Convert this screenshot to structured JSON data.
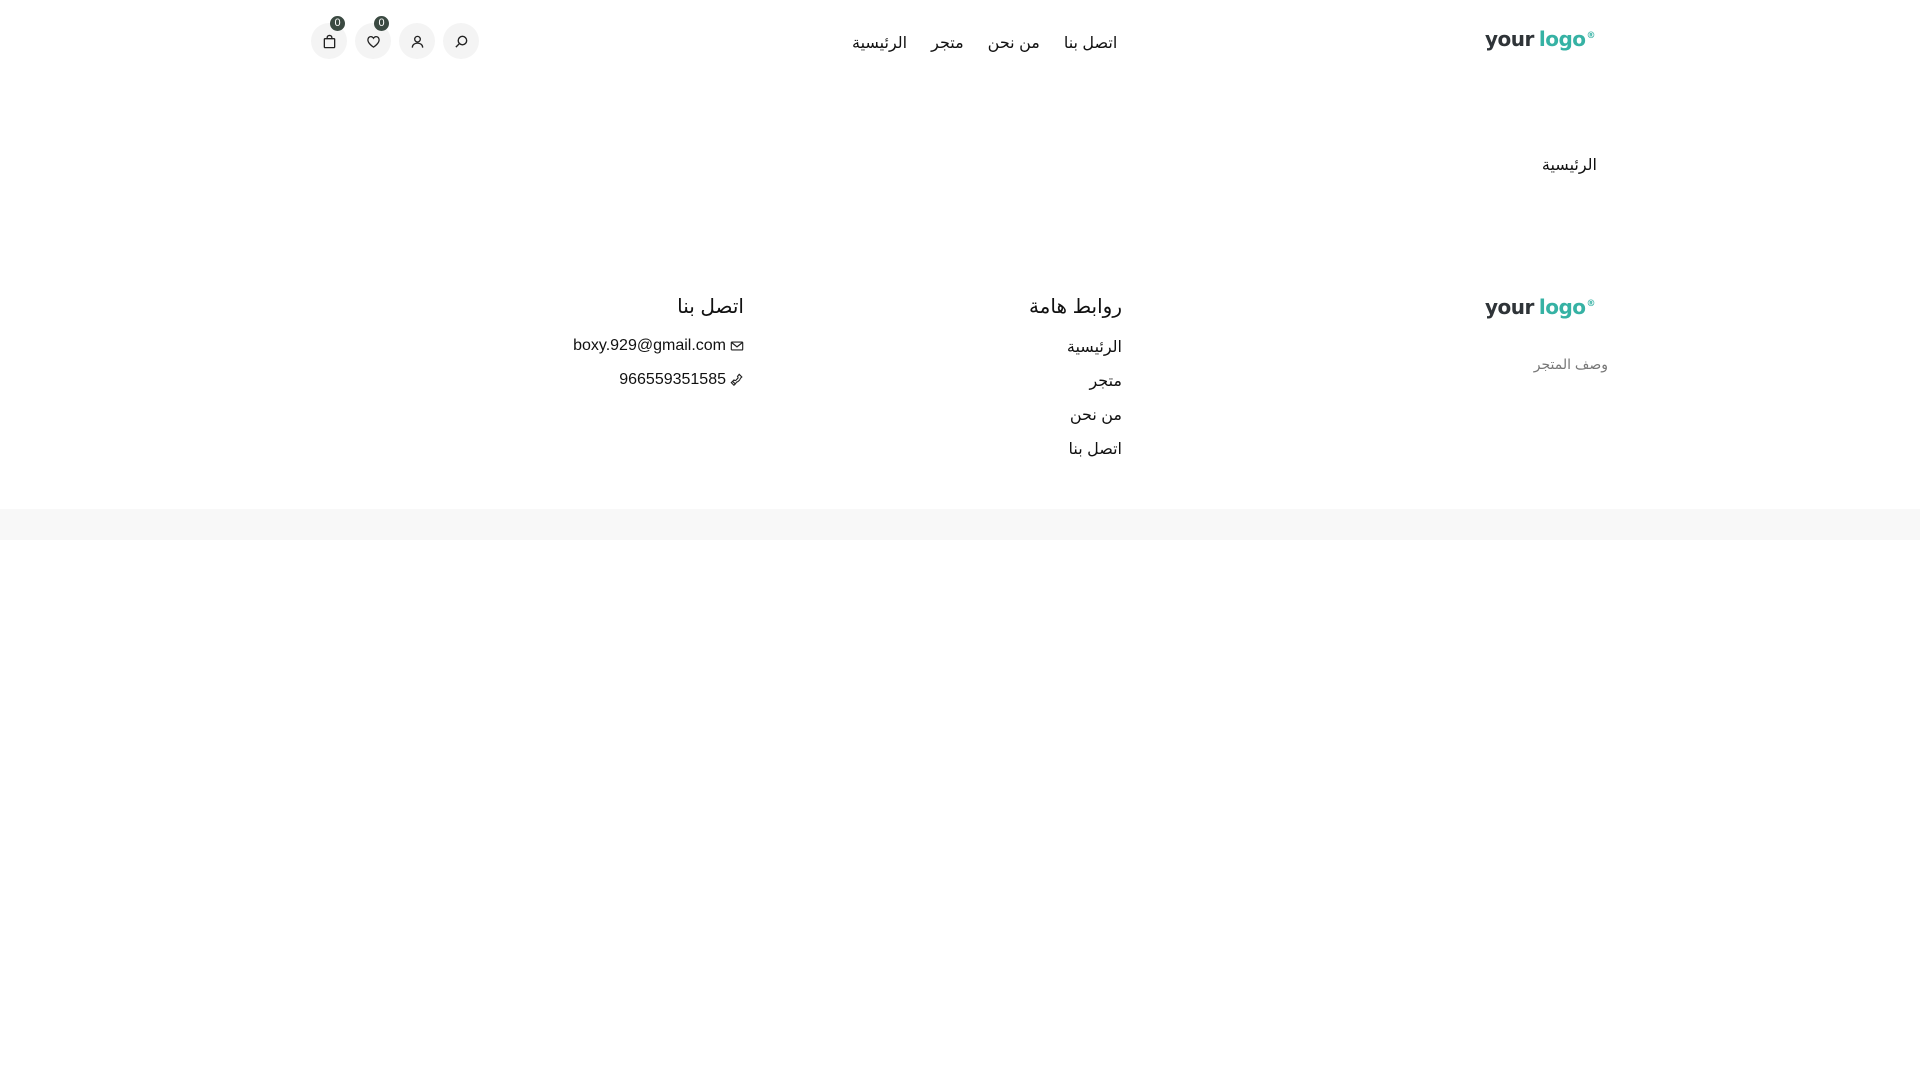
{
  "header": {
    "logo": {
      "word1": "your",
      "word2": "logo",
      "mark": "®"
    },
    "nav": [
      {
        "label": "الرئيسية"
      },
      {
        "label": "متجر"
      },
      {
        "label": "من نحن"
      },
      {
        "label": "اتصل بنا"
      }
    ],
    "icons": {
      "search": "search-icon",
      "account": "user-icon",
      "wishlist": "heart-icon",
      "cart": "bag-icon"
    },
    "wishlist_count": "0",
    "cart_count": "0"
  },
  "breadcrumb": {
    "current": "الرئيسية"
  },
  "footer": {
    "logo": {
      "word1": "your",
      "word2": "logo",
      "mark": "®"
    },
    "store_description": "وصف المتجر",
    "links": {
      "title": "روابط هامة",
      "items": [
        "الرئيسية",
        "متجر",
        "من نحن",
        "اتصل بنا"
      ]
    },
    "contact": {
      "title": "اتصل بنا",
      "email": "boxy.929@gmail.com",
      "phone": "966559351585",
      "email_icon": "mail-icon",
      "phone_icon": "phone-icon"
    }
  },
  "colors": {
    "logo_dark": "#2f3438",
    "logo_accent": "#36b2a4",
    "badge": "#3b4a42",
    "icon_bg": "#f4f4f4",
    "bottom_bar": "#f8f8f8"
  }
}
